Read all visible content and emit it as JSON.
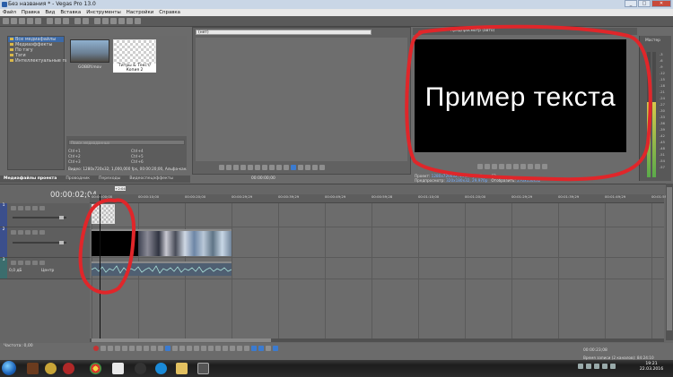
{
  "window": {
    "title": "Без названия * - Vegas Pro 13.0",
    "buttons": [
      "_",
      "□",
      "✕"
    ]
  },
  "menu": [
    "Файл",
    "Правка",
    "Вид",
    "Вставка",
    "Инструменты",
    "Настройки",
    "Справка"
  ],
  "project_media": {
    "tree": [
      "Все медиафайлы",
      "Медиаэффекты",
      "По тэгу",
      "Тэги",
      "Интеллектуальные пап"
    ],
    "thumbnails": [
      {
        "caption": "GOBBY.mov"
      },
      {
        "caption": "Титры & Текст/ Копия 2"
      }
    ],
    "search_placeholder": "Поиск медиаданных",
    "shortcuts": [
      "Ctrl+1",
      "Ctrl+2",
      "Ctrl+3",
      "Ctrl+4",
      "Ctrl+5",
      "Ctrl+6"
    ],
    "media_info": "Видео: 1280x720x32; 1,000,000 fps, 00:00:20;00, Альфа-канал + Пр"
  },
  "left_tabs": [
    "Медиафайлы проекта",
    "Проводник",
    "Переходы",
    "Видеоспецэффекты"
  ],
  "trimmer": {
    "dropdown": "(нет)",
    "timecode": "00:00:00;00"
  },
  "preview": {
    "toolbar_label": "Предпросмотр (авто)",
    "text": "Пример текста",
    "info": {
      "project_label": "Проект:",
      "project_value": "1280x720x32, 29,970p",
      "preview_label": "Предпросмотр:",
      "preview_value": "320x180x32, 29,970p",
      "frame_label": "Кадр:",
      "frame_value": "62",
      "display_label": "Отобразить:",
      "display_value": "270x150x32"
    }
  },
  "meter": {
    "label": "Мастер",
    "scale": [
      "-3",
      "-6",
      "-9",
      "-12",
      "-15",
      "-18",
      "-21",
      "-24",
      "-27",
      "-30",
      "-33",
      "-36",
      "-39",
      "-42",
      "-45",
      "-48",
      "-51",
      "-54",
      "-57"
    ],
    "level_fraction": 0.6
  },
  "timeline": {
    "timecode": "00:00:02;04",
    "marker": "+2:04",
    "ruler_ticks": [
      "00:00:00;00",
      "00:00:10;00",
      "00:00:20;00",
      "00:00:29;29",
      "00:00:39;29",
      "00:00:49;29",
      "00:00:59;28",
      "00:01:10;00",
      "00:01:20;00",
      "00:01:29;29",
      "00:01:39;29",
      "00:01:49;29",
      "00:01:59;28"
    ],
    "tracks": [
      {
        "num": "1",
        "type": "video"
      },
      {
        "num": "2",
        "type": "video"
      },
      {
        "num": "3",
        "type": "audio",
        "level": "0,0 дБ",
        "pan": "Центр"
      }
    ]
  },
  "status": {
    "rate": "Частота: 0,00",
    "end_time": "00:00:23;08",
    "record_time": "Время записи (2 каналов): 84:24:10"
  },
  "taskbar": {
    "clock_time": "19:21",
    "clock_date": "22.03.2016"
  },
  "colors": {
    "annotation_red": "#e0262a",
    "selection_blue": "#3b7bd0"
  }
}
